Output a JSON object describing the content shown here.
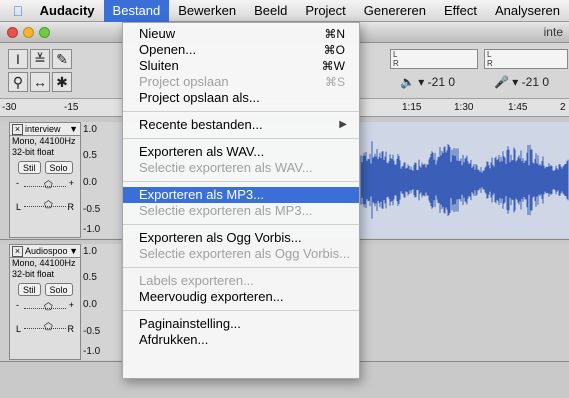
{
  "menubar": {
    "app_name": "Audacity",
    "items": [
      "Bestand",
      "Bewerken",
      "Beeld",
      "Project",
      "Genereren",
      "Effect",
      "Analyseren"
    ]
  },
  "window": {
    "title_partial": "inte"
  },
  "ruler": {
    "labels": [
      "-30",
      "-15",
      "1:15",
      "1:30",
      "1:45",
      "2"
    ]
  },
  "meters": {
    "left_label": "L",
    "right_label": "R",
    "db_value_1": "-21 0",
    "db_value_2": "-21 0"
  },
  "tracks": [
    {
      "name": "interview",
      "info1": "Mono, 44100Hz",
      "info2": "32-bit float",
      "mute": "Stil",
      "solo": "Solo",
      "scale": [
        "1.0",
        "0.5",
        "0.0",
        "-0.5",
        "-1.0"
      ],
      "pan_left": "L",
      "pan_right": "R"
    },
    {
      "name": "Audiospoo",
      "info1": "Mono, 44100Hz",
      "info2": "32-bit float",
      "mute": "Stil",
      "solo": "Solo",
      "scale": [
        "1.0",
        "0.5",
        "0.0",
        "-0.5",
        "-1.0"
      ],
      "pan_left": "L",
      "pan_right": "R"
    }
  ],
  "file_menu": {
    "items": [
      {
        "label": "Nieuw",
        "shortcut": "⌘N",
        "enabled": true
      },
      {
        "label": "Openen...",
        "shortcut": "⌘O",
        "enabled": true
      },
      {
        "label": "Sluiten",
        "shortcut": "⌘W",
        "enabled": true
      },
      {
        "label": "Project opslaan",
        "shortcut": "⌘S",
        "enabled": false
      },
      {
        "label": "Project opslaan als...",
        "shortcut": "",
        "enabled": true
      },
      {
        "label": "Recente bestanden...",
        "shortcut": "",
        "enabled": true
      },
      {
        "label": "Exporteren als WAV...",
        "shortcut": "",
        "enabled": true
      },
      {
        "label": "Selectie exporteren als WAV...",
        "shortcut": "",
        "enabled": false
      },
      {
        "label": "Exporteren als MP3...",
        "shortcut": "",
        "enabled": true
      },
      {
        "label": "Selectie exporteren als MP3...",
        "shortcut": "",
        "enabled": false
      },
      {
        "label": "Exporteren als Ogg Vorbis...",
        "shortcut": "",
        "enabled": true
      },
      {
        "label": "Selectie exporteren als Ogg Vorbis...",
        "shortcut": "",
        "enabled": false
      },
      {
        "label": "Labels exporteren...",
        "shortcut": "",
        "enabled": false
      },
      {
        "label": "Meervoudig exporteren...",
        "shortcut": "",
        "enabled": true
      },
      {
        "label": "Paginainstelling...",
        "shortcut": "",
        "enabled": true
      },
      {
        "label": "Afdrukken...",
        "shortcut": "",
        "enabled": true
      }
    ],
    "highlighted": "Exporteren als MP3..."
  },
  "colors": {
    "menu_highlight": "#3a6fd8",
    "waveform": "#3b5fb8"
  }
}
